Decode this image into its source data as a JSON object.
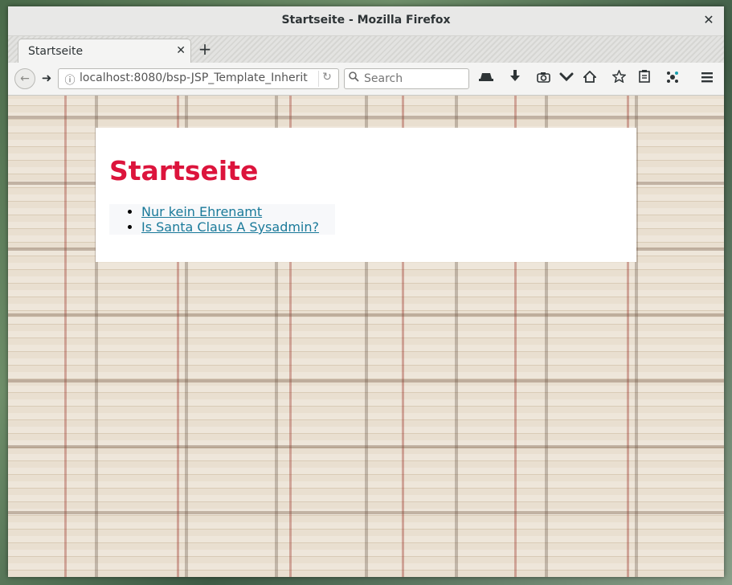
{
  "window": {
    "title": "Startseite - Mozilla Firefox",
    "close_glyph": "✕"
  },
  "tabs": [
    {
      "label": "Startseite",
      "close_glyph": "✕"
    }
  ],
  "newtab_glyph": "+",
  "navbar": {
    "back_glyph": "←",
    "forward_glyph": "➜",
    "url": "localhost:8080/bsp-JSP_Template_Inherit",
    "reload_glyph": "↻",
    "search_placeholder": "Search",
    "toolbar_icons": [
      "incognito-icon",
      "download-icon",
      "screenshot-icon",
      "pocket-icon",
      "home-icon",
      "bookmark-star-icon",
      "reader-icon",
      "extension-icon",
      "menu-icon"
    ]
  },
  "page": {
    "heading": "Startseite",
    "links": [
      "Nur kein Ehrenamt",
      "Is Santa Claus A Sysadmin?"
    ],
    "heading_color": "#dc143c",
    "link_color": "#1a7a9a"
  }
}
